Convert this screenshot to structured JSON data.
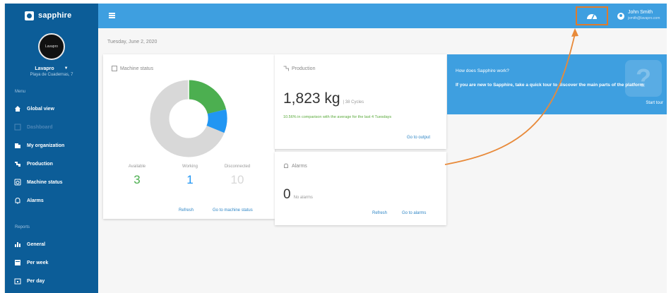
{
  "app": {
    "brand": "sapphire"
  },
  "sidebar": {
    "avatar_text": "Lavapro",
    "user_name": "Lavapro",
    "user_location": "Playa de Cuadernas, 7",
    "menu_label": "Menu",
    "menu_items": [
      {
        "label": "Global view",
        "icon": "home-icon"
      },
      {
        "label": "Dashboard",
        "icon": "dashboard-icon"
      },
      {
        "label": "My organization",
        "icon": "building-icon"
      },
      {
        "label": "Production",
        "icon": "production-icon"
      },
      {
        "label": "Machine status",
        "icon": "machine-icon"
      },
      {
        "label": "Alarms",
        "icon": "bell-icon"
      }
    ],
    "reports_label": "Reports",
    "report_items": [
      {
        "label": "General",
        "icon": "bar-chart-icon"
      },
      {
        "label": "Per week",
        "icon": "calendar-week-icon"
      },
      {
        "label": "Per day",
        "icon": "calendar-day-icon"
      }
    ]
  },
  "topbar": {
    "user_name": "John Smith",
    "user_email": "jsmith@lavapro.com"
  },
  "main": {
    "date": "Tuesday, June 2, 2020",
    "machine_status": {
      "title": "Machine status",
      "stats": [
        {
          "label": "Available",
          "value": "3",
          "color": "#4caf50"
        },
        {
          "label": "Working",
          "value": "1",
          "color": "#2196f3"
        },
        {
          "label": "Disconnected",
          "value": "10",
          "color": "#d8d8d8"
        }
      ],
      "refresh": "Refresh",
      "go_to": "Go to machine status"
    },
    "production": {
      "title": "Production",
      "value": "1,823 kg",
      "cycles": "| 38 Cycles",
      "comparison": "10.56% in comparison with the average for the last 4 Tuesdays",
      "go_to": "Go to output"
    },
    "alarms": {
      "title": "Alarms",
      "value": "0",
      "sub": "No alarms",
      "refresh": "Refresh",
      "go_to": "Go to alarms"
    },
    "tour": {
      "title": "How does Sapphire work?",
      "text": "If you are new to Sapphire, take a quick tour to discover the main parts of the platform",
      "start": "Start tour"
    }
  },
  "colors": {
    "sidebar": "#0c5d98",
    "topbar": "#3e9fe0",
    "highlight": "#e07b2b",
    "available": "#4caf50",
    "working": "#2196f3",
    "disconnected": "#d8d8d8"
  }
}
